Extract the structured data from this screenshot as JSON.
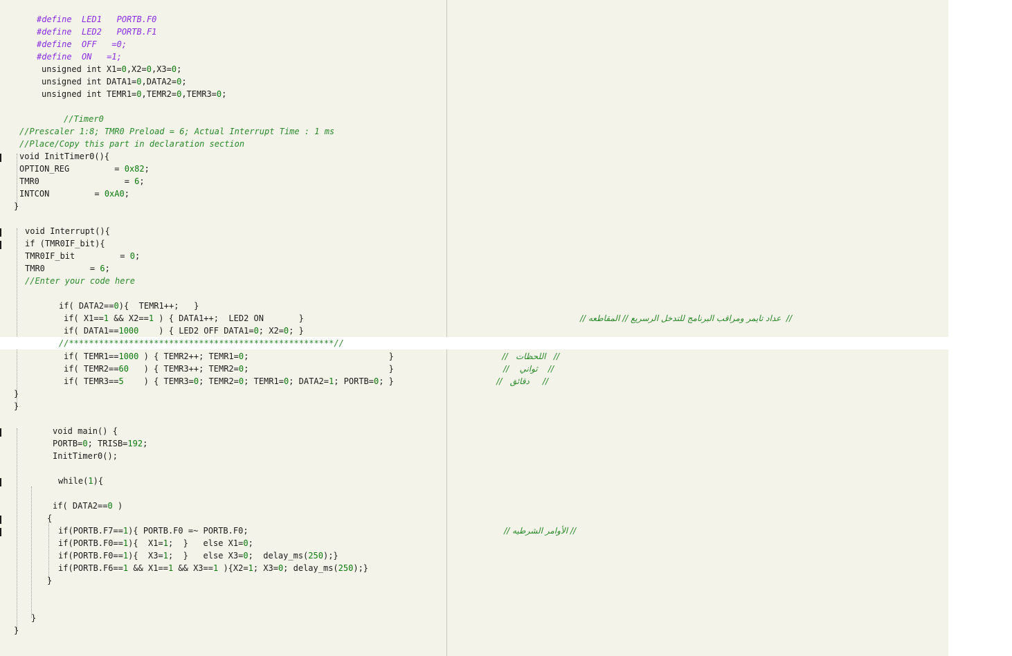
{
  "code": {
    "l1": [
      "#define  LED1   PORTB.F0"
    ],
    "l2": [
      "#define  LED2   PORTB.F1"
    ],
    "l3": [
      "#define  OFF   =0;"
    ],
    "l4": [
      "#define  ON   =1;"
    ],
    "l5": [
      "unsigned int X1=",
      "0",
      ",X2=",
      "0",
      ",X3=",
      "0",
      ";"
    ],
    "l6": [
      "unsigned int DATA1=",
      "0",
      ",DATA2=",
      "0",
      ";"
    ],
    "l7": [
      "unsigned int TEMR1=",
      "0",
      ",TEMR2=",
      "0",
      ",TEMR3=",
      "0",
      ";"
    ],
    "l8": [
      "//Timer0"
    ],
    "l9": [
      "//Prescaler 1:8; TMR0 Preload = 6; Actual Interrupt Time : 1 ms"
    ],
    "l10": [
      "//Place/Copy this part in declaration section"
    ],
    "l11": [
      "void InitTimer0(){"
    ],
    "l12": [
      "OPTION_REG         = ",
      "0x82",
      ";"
    ],
    "l13": [
      "TMR0                 = ",
      "6",
      ";"
    ],
    "l14": [
      "INTCON         = ",
      "0xA0",
      ";"
    ],
    "l15": [
      "}"
    ],
    "l16": [
      "void Interrupt(){"
    ],
    "l17": [
      "if (TMR0IF_bit){"
    ],
    "l18": [
      "TMR0IF_bit         = ",
      "0",
      ";"
    ],
    "l19": [
      "TMR0         = ",
      "6",
      ";"
    ],
    "l20": [
      "//Enter your code here"
    ],
    "l21": [
      "if( DATA2==",
      "0",
      "){  TEMR1++;   }"
    ],
    "l22": [
      "if( X1==",
      "1",
      " && X2==",
      "1",
      " ) { DATA1++;  LED2 ON       }"
    ],
    "l23": [
      "if( DATA1==",
      "1000",
      "    ) { LED2 OFF DATA1=",
      "0",
      "; X2=",
      "0",
      "; }"
    ],
    "l24": [
      "//*****************************************************//"
    ],
    "l25": [
      "if( TEMR1==",
      "1000",
      " ) { TEMR2++; TEMR1=",
      "0",
      ";                            }"
    ],
    "l26": [
      "if( TEMR2==",
      "60",
      "   ) { TEMR3++; TEMR2=",
      "0",
      ";                            }"
    ],
    "l27": [
      "if( TEMR3==",
      "5",
      "    ) { TEMR3=",
      "0",
      "; TEMR2=",
      "0",
      "; TEMR1=",
      "0",
      "; DATA2=",
      "1",
      "; PORTB=",
      "0",
      "; }"
    ],
    "l28": [
      "}"
    ],
    "l29": [
      "}"
    ],
    "l30": [
      "void main() {"
    ],
    "l31": [
      "PORTB=",
      "0",
      "; TRISB=",
      "192",
      ";"
    ],
    "l32": [
      "InitTimer0();"
    ],
    "l33": [
      "while(",
      "1",
      "){"
    ],
    "l34": [
      "if( DATA2==",
      "0",
      " )"
    ],
    "l35": [
      "{"
    ],
    "l36": [
      "if(PORTB.F7==",
      "1",
      "){ PORTB.F0 =~ PORTB.F0;"
    ],
    "l37": [
      "if(PORTB.F0==",
      "1",
      "){  X1=",
      "1",
      ";  }   else X1=",
      "0",
      ";"
    ],
    "l38": [
      "if(PORTB.F0==",
      "1",
      "){  X3=",
      "1",
      ";  }   else X3=",
      "0",
      ";  delay_ms(",
      "250",
      ");}"
    ],
    "l39": [
      "if(PORTB.F6==",
      "1",
      " && X1==",
      "1",
      " && X3==",
      "1",
      " ){X2=",
      "1",
      "; X3=",
      "0",
      "; delay_ms(",
      "250",
      ");}"
    ],
    "l40": [
      "}"
    ],
    "l41": [
      "}"
    ],
    "l42": [
      "}"
    ]
  },
  "comments": {
    "c1": "//  عداد تايمر ومراقب البرنامج للتدخل الرسريع // المقاطعه //",
    "c2": "//   اللحظات   //",
    "c3": "//    ثواني    //",
    "c4": "//     دقائق   //",
    "c5": "// الأوامر الشرطيه //"
  },
  "colors": {
    "background": "#f3f3ea",
    "directive": "#8a2be2",
    "comment": "#2a8a2a",
    "number": "#0a7a0a",
    "text": "#1a1a1a"
  }
}
